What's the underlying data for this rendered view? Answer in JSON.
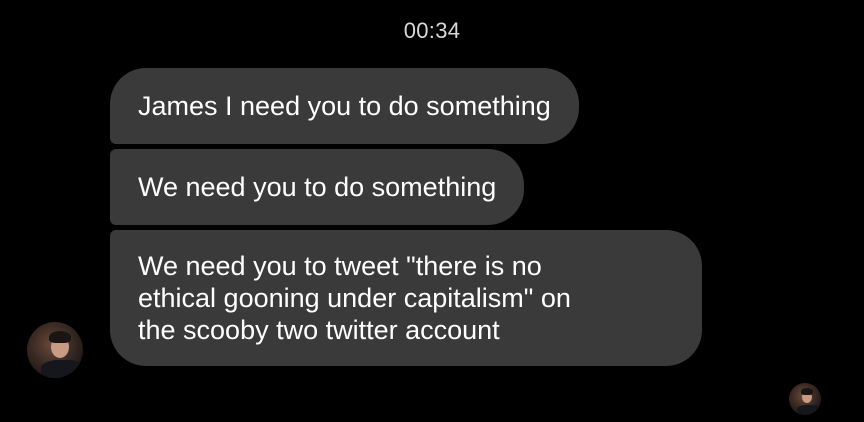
{
  "chat": {
    "timestamp": "00:34",
    "messages": [
      {
        "text": "James I need you to do something"
      },
      {
        "text": "We need you to do something"
      },
      {
        "text": "We need you to tweet \"there is no\nethical gooning under capitalism\" on\nthe scooby two twitter account"
      }
    ]
  },
  "icons": {
    "sender_avatar": "profile-photo",
    "read_receipt": "profile-photo-small"
  },
  "colors": {
    "background": "#000000",
    "bubble": "#3a3a3a",
    "text": "#ffffff",
    "timestamp": "#d9d9d9"
  }
}
